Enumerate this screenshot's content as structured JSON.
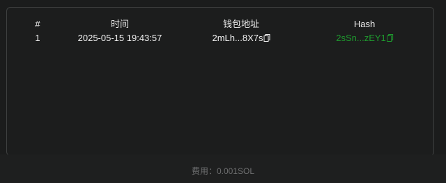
{
  "table": {
    "headers": {
      "index": "#",
      "time": "时间",
      "wallet": "钱包地址",
      "hash": "Hash"
    },
    "rows": [
      {
        "index": "1",
        "time": "2025-05-15 19:43:57",
        "wallet": "2mLh...8X7s",
        "hash": "2sSn...zEY1"
      }
    ]
  },
  "footer": {
    "fee_label": "费用：",
    "fee_value": "0.001SOL"
  },
  "icons": {
    "copy": "copy-icon"
  },
  "colors": {
    "background": "#1b1c1c",
    "text": "#f0f0f0",
    "hash_link": "#1e9a2e",
    "muted": "#6e6f70",
    "border": "#3e4040"
  }
}
